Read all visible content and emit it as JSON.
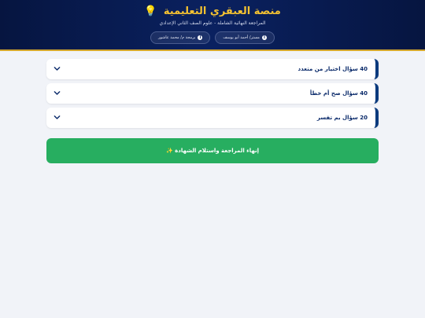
{
  "header": {
    "brand_title": "منصة العبقري التعليمية",
    "bulb_icon": "💡",
    "subtitle": "المراجعة النهائية الشاملة - علوم الصف الثاني الإعدادي",
    "pills": [
      {
        "icon": "info-icon",
        "label": "مستر/ أحمد أبو يوسف"
      },
      {
        "icon": "info-icon",
        "label": "برمجة م/ محمد عاشور"
      }
    ]
  },
  "sections": [
    {
      "title": "40 سؤال اختيار من متعدد"
    },
    {
      "title": "40 سؤال صح أم خطأ"
    },
    {
      "title": "20 سؤال بم تفسر"
    }
  ],
  "finish_button": {
    "label": "إنهاء المراجعة واستلام الشهادة ✨"
  },
  "colors": {
    "header_bg": "#0a2160",
    "brand_gold": "#f5c231",
    "section_accent": "#0a3a7d",
    "finish_green": "#27ae60",
    "page_bg": "#f1f3f8"
  }
}
